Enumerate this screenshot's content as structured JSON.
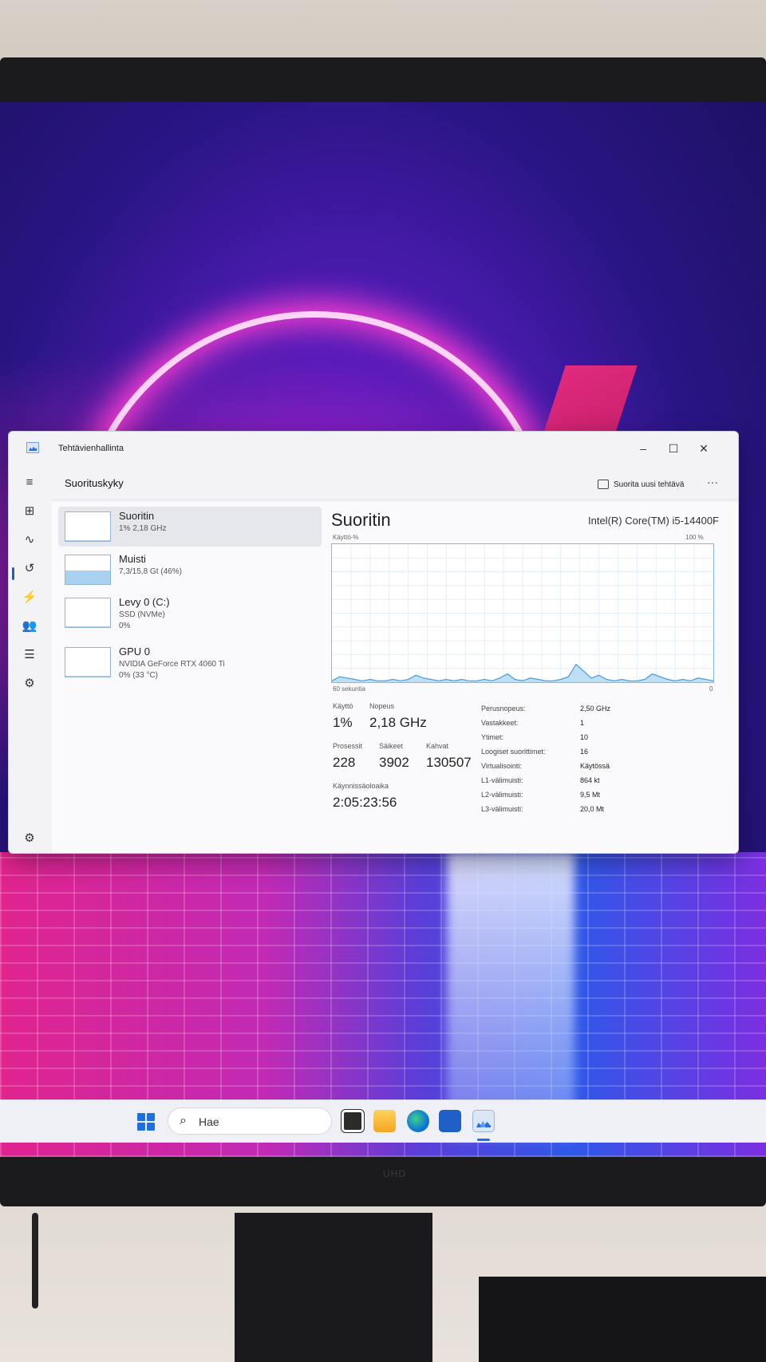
{
  "window": {
    "title": "Tehtävienhallinta",
    "min_glyph": "–",
    "max_glyph": "☐",
    "close_glyph": "✕"
  },
  "header": {
    "page_title": "Suorituskyky",
    "run_task_label": "Suorita uusi tehtävä",
    "more_glyph": "···"
  },
  "devices": [
    {
      "name": "Suoritin",
      "line1": "1%  2,18 GHz",
      "line2": "",
      "fill": 0.02
    },
    {
      "name": "Muisti",
      "line1": "7,3/15,8 Gt (46%)",
      "line2": "",
      "fill": 0.46
    },
    {
      "name": "Levy 0 (C:)",
      "line1": "SSD (NVMe)",
      "line2": "0%",
      "fill": 0.0
    },
    {
      "name": "GPU 0",
      "line1": "NVIDIA GeForce RTX 4060 Ti",
      "line2": "0%  (33 °C)",
      "fill": 0.0
    }
  ],
  "performance": {
    "title": "Suoritin",
    "cpu_model": "Intel(R) Core(TM) i5-14400F",
    "y_label": "Käyttö-%",
    "y_max_label": "100 %",
    "x_label": "60 sekuntia",
    "x_min_label": "0",
    "stats": {
      "usage_label": "Käyttö",
      "usage_value": "1%",
      "speed_label": "Nopeus",
      "speed_value": "2,18 GHz",
      "processes_label": "Prosessit",
      "processes_value": "228",
      "threads_label": "Säikeet",
      "threads_value": "3902",
      "handles_label": "Kahvat",
      "handles_value": "130507",
      "uptime_label": "Käynnissäoloaika",
      "uptime_value": "2:05:23:56"
    },
    "specs": [
      {
        "label": "Perusnopeus:",
        "value": "2,50 GHz"
      },
      {
        "label": "Vastakkeet:",
        "value": "1"
      },
      {
        "label": "Ytimet:",
        "value": "10"
      },
      {
        "label": "Loogiset suorittimet:",
        "value": "16"
      },
      {
        "label": "Virtualisointi:",
        "value": "Käytössä"
      },
      {
        "label": "L1-välimuisti:",
        "value": "864 kt"
      },
      {
        "label": "L2-välimuisti:",
        "value": "9,5 Mt"
      },
      {
        "label": "L3-välimuisti:",
        "value": "20,0 Mt"
      }
    ],
    "usage_history_percent": [
      1,
      4,
      3,
      2,
      1,
      2,
      1,
      1,
      2,
      1,
      2,
      5,
      3,
      2,
      1,
      2,
      1,
      2,
      1,
      1,
      2,
      1,
      3,
      6,
      2,
      1,
      3,
      2,
      1,
      1,
      2,
      4,
      13,
      8,
      3,
      5,
      2,
      1,
      2,
      1,
      1,
      2,
      6,
      4,
      2,
      1,
      2,
      1,
      3,
      2,
      1
    ],
    "line_color": "#4a9bd6",
    "fill_color": "#bfe0f4"
  },
  "taskbar": {
    "search_placeholder": "Hae",
    "search_glyph": "⌕"
  },
  "monitor": {
    "brand": "UHD"
  }
}
